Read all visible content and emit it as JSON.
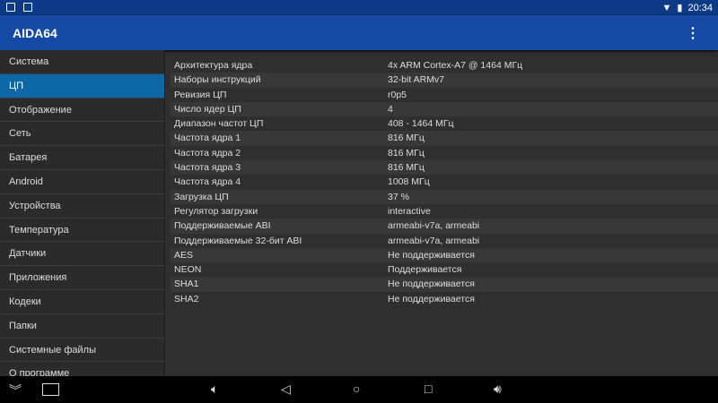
{
  "status": {
    "time": "20:34"
  },
  "app": {
    "title": "AIDA64",
    "menu_icon": "more-vert-icon"
  },
  "sidebar": {
    "items": [
      "Система",
      "ЦП",
      "Отображение",
      "Сеть",
      "Батарея",
      "Android",
      "Устройства",
      "Температура",
      "Датчики",
      "Приложения",
      "Кодеки",
      "Папки",
      "Системные файлы",
      "О программе"
    ],
    "selected": 1
  },
  "rows": [
    [
      "Архитектура ядра",
      "4x ARM Cortex-A7 @ 1464 МГц"
    ],
    [
      "Наборы инструкций",
      "32-bit ARMv7"
    ],
    [
      "Ревизия ЦП",
      "r0p5"
    ],
    [
      "Число ядер ЦП",
      "4"
    ],
    [
      "Диапазон частот ЦП",
      "408 - 1464 МГц"
    ],
    [
      "Частота ядра 1",
      "816 МГц"
    ],
    [
      "Частота ядра 2",
      "816 МГц"
    ],
    [
      "Частота ядра 3",
      "816 МГц"
    ],
    [
      "Частота ядра 4",
      "1008 МГц"
    ],
    [
      "Загрузка ЦП",
      "37 %"
    ],
    [
      "Регулятор загрузки",
      "interactive"
    ],
    [
      "Поддерживаемые ABI",
      "armeabi-v7a, armeabi"
    ],
    [
      "Поддерживаемые 32-бит ABI",
      "armeabi-v7a, armeabi"
    ],
    [
      "AES",
      "Не поддерживается"
    ],
    [
      "NEON",
      "Поддерживается"
    ],
    [
      "SHA1",
      "Не поддерживается"
    ],
    [
      "SHA2",
      "Не поддерживается"
    ]
  ],
  "colors": {
    "accent": "#1449a6",
    "selected": "#0e68a6"
  }
}
